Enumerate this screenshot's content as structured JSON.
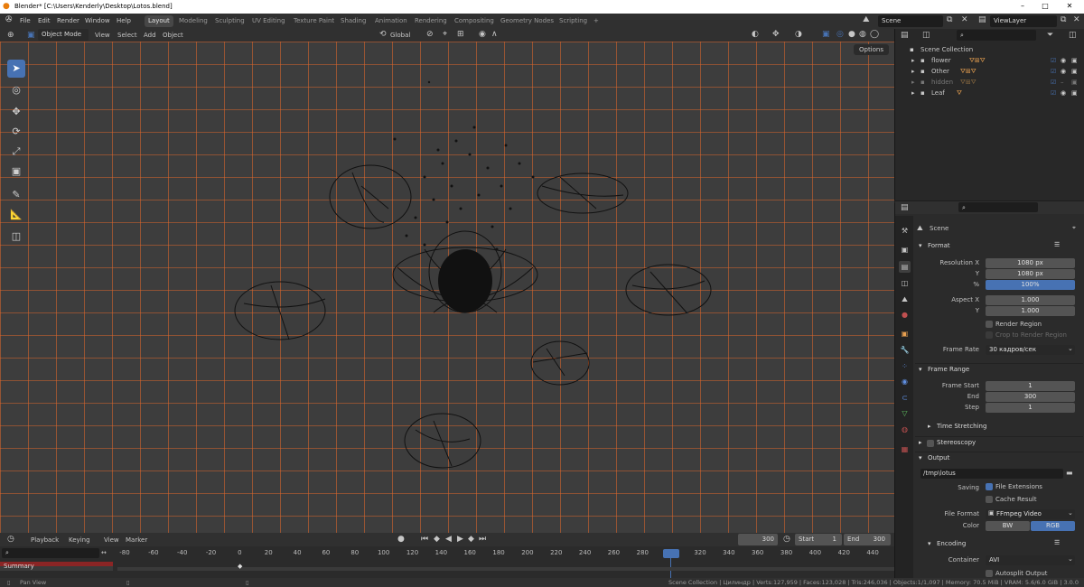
{
  "window": {
    "title": "Blender* [C:\\Users\\Kenderly\\Desktop\\Lotos.blend]"
  },
  "menu": {
    "file": "File",
    "edit": "Edit",
    "render": "Render",
    "window": "Window",
    "help": "Help"
  },
  "workspaces": [
    "Layout",
    "Modeling",
    "Sculpting",
    "UV Editing",
    "Texture Paint",
    "Shading",
    "Animation",
    "Rendering",
    "Compositing",
    "Geometry Nodes",
    "Scripting"
  ],
  "workspace_add": "+",
  "scene": {
    "name": "Scene",
    "view_layer": "ViewLayer"
  },
  "viewport_header": {
    "mode": "Object Mode",
    "view": "View",
    "select": "Select",
    "add": "Add",
    "object": "Object",
    "transform": "Global",
    "options": "Options"
  },
  "outliner": {
    "root": "Scene Collection",
    "items": [
      {
        "name": "flower",
        "muted": false
      },
      {
        "name": "Other",
        "muted": false
      },
      {
        "name": "hidden",
        "muted": true
      },
      {
        "name": "Leaf",
        "muted": false
      }
    ]
  },
  "properties": {
    "context": "Scene",
    "format": {
      "title": "Format",
      "res_x_label": "Resolution X",
      "res_x": "1080 px",
      "res_y_label": "Y",
      "res_y": "1080 px",
      "percent_label": "%",
      "percent": "100%",
      "aspect_x_label": "Aspect X",
      "aspect_x": "1.000",
      "aspect_y_label": "Y",
      "aspect_y": "1.000",
      "render_region": "Render Region",
      "crop": "Crop to Render Region",
      "frame_rate_label": "Frame Rate",
      "frame_rate": "30 кадров/сек"
    },
    "frame_range": {
      "title": "Frame Range",
      "start_label": "Frame Start",
      "start": "1",
      "end_label": "End",
      "end": "300",
      "step_label": "Step",
      "step": "1"
    },
    "time_stretching": "Time Stretching",
    "stereoscopy": "Stereoscopy",
    "output": {
      "title": "Output",
      "path": "/tmp\\lotus",
      "saving_label": "Saving",
      "file_extensions": "File Extensions",
      "cache_result": "Cache Result",
      "file_format_label": "File Format",
      "file_format": "FFmpeg Video",
      "color_label": "Color",
      "color_bw": "BW",
      "color_rgb": "RGB"
    },
    "encoding": {
      "title": "Encoding",
      "container_label": "Container",
      "container": "AVI",
      "autosplit": "Autosplit Output"
    }
  },
  "timeline": {
    "playback": "Playback",
    "keying": "Keying",
    "view": "View",
    "marker": "Marker",
    "current_frame": "300",
    "start_label": "Start",
    "start": "1",
    "end_label": "End",
    "end": "300",
    "summary": "Summary",
    "ticks": [
      "-80",
      "-60",
      "-40",
      "-20",
      "0",
      "20",
      "40",
      "60",
      "80",
      "100",
      "120",
      "140",
      "160",
      "180",
      "200",
      "220",
      "240",
      "260",
      "280",
      "300",
      "320",
      "340",
      "360",
      "380",
      "400",
      "420",
      "440"
    ]
  },
  "statusbar": {
    "pan": "Pan View",
    "stats": "Scene Collection | Цилиндр | Verts:127,959 | Faces:123,028 | Tris:246,036 | Objects:1/1,097 | Memory: 70.5 MiB | VRAM: 5.6/6.0 GiB | 3.0.0"
  },
  "colors": {
    "accent": "#4772b3",
    "grid": "#e0662a",
    "viewport_bg": "#3d3d3d"
  }
}
